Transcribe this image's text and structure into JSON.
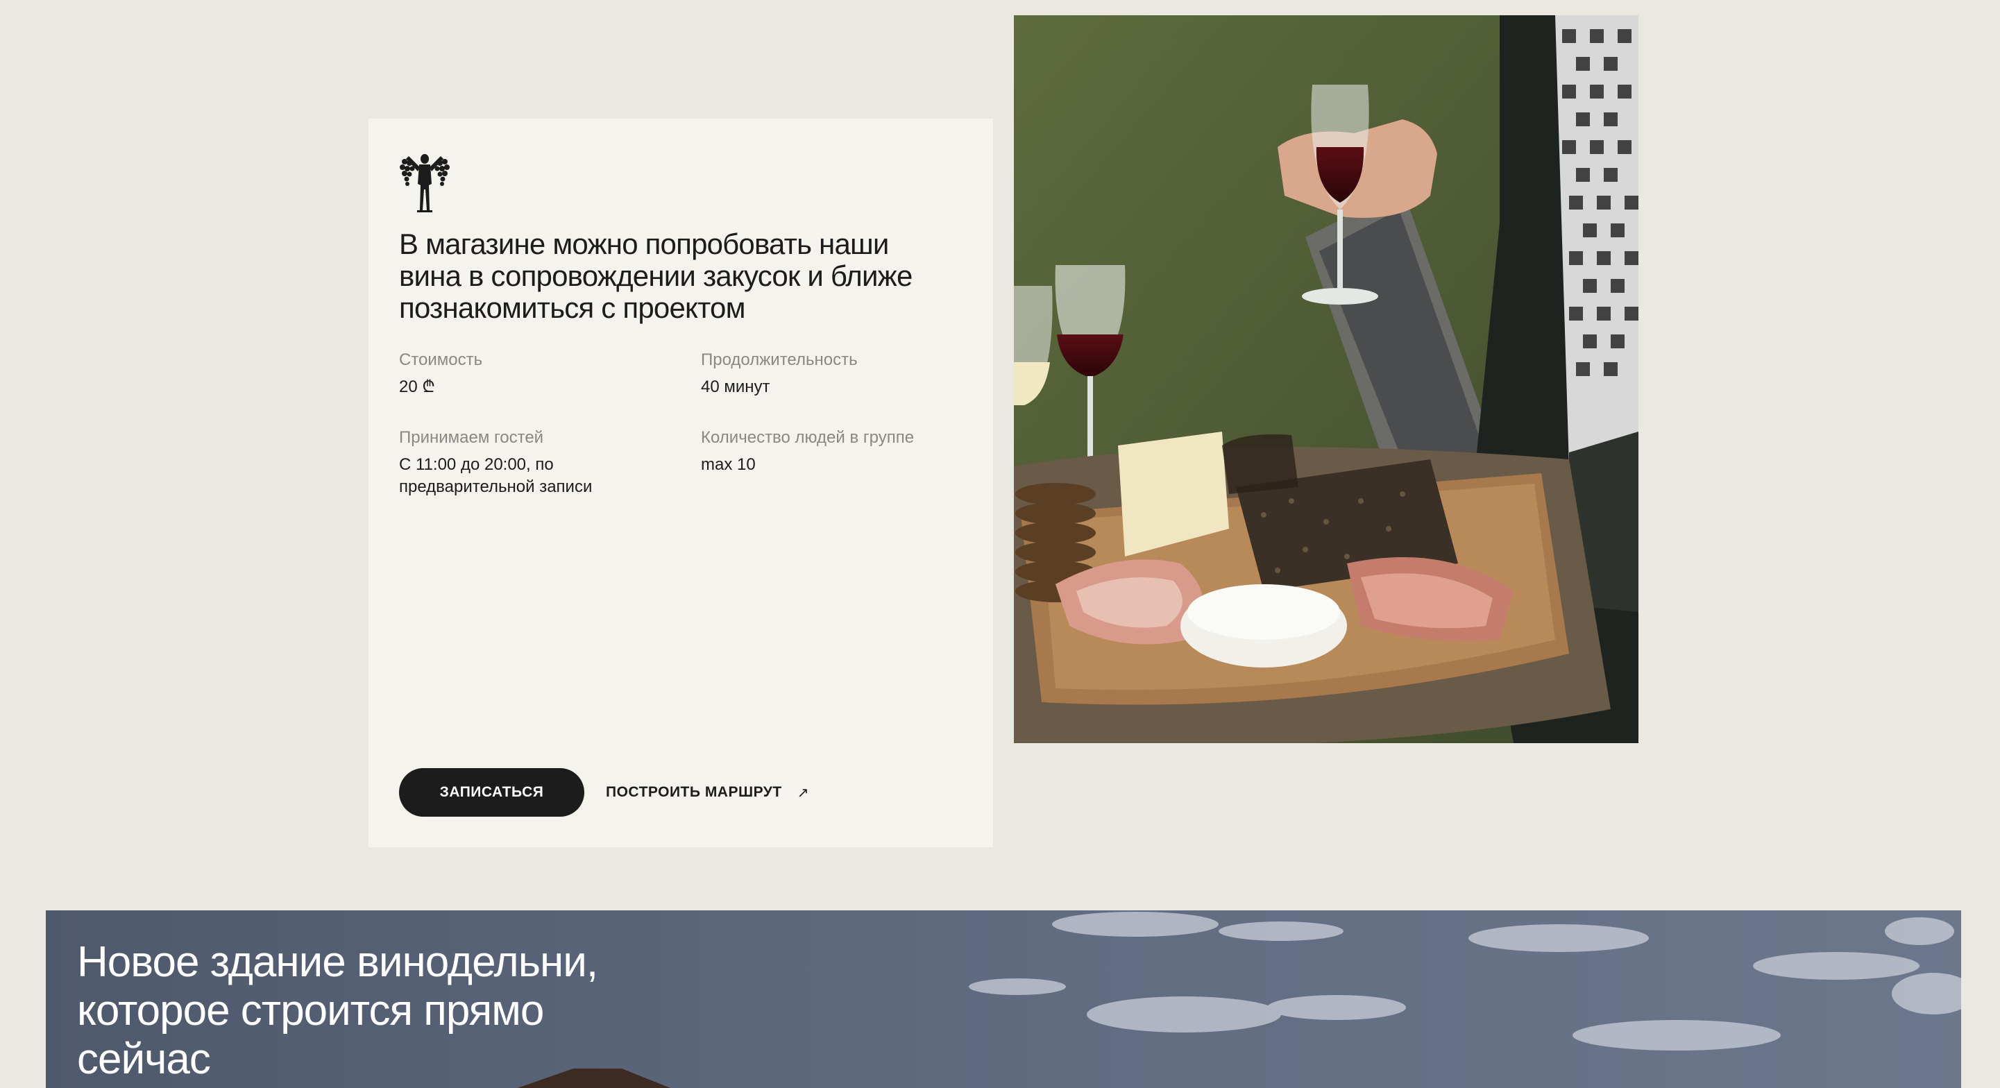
{
  "tasting": {
    "logo_icon": "winery-figure-with-grapes-icon",
    "headline": "В магазине можно попробовать наши вина в сопровождении закусок и ближе познакомиться с проектом",
    "details": [
      {
        "label": "Стоимость",
        "value": "20 ₾"
      },
      {
        "label": "Продолжительность",
        "value": "40 минут"
      },
      {
        "label": "Принимаем гостей",
        "value": "С 11:00 до 20:00, по предварительной записи"
      },
      {
        "label": "Количество людей в группе",
        "value": "max 10"
      }
    ],
    "book_button": "ЗАПИСАТЬСЯ",
    "route_link": "ПОСТРОИТЬ МАРШРУТ",
    "route_icon": "arrow-up-right-icon",
    "photo_icon": "wine-and-snacks-photo"
  },
  "building": {
    "title": "Новое здание винодельни, которое строится прямо сейчас",
    "photo_icon": "sky-and-building-photo"
  },
  "colors": {
    "page_bg": "#ebe8e2",
    "card_bg": "#f4f3ee",
    "text": "#1c1c1c",
    "muted": "#8a8883",
    "button_bg": "#1c1c1c",
    "banner_bg": "#5a6478"
  }
}
